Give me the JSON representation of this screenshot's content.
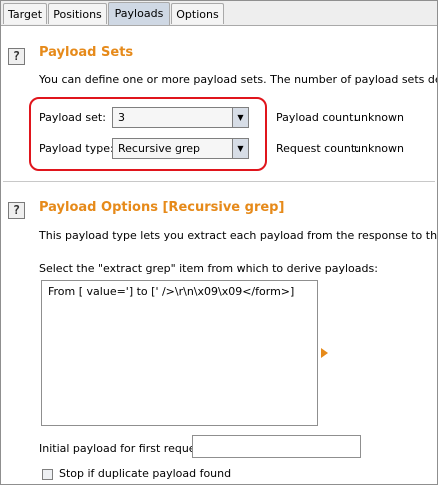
{
  "tabs": [
    {
      "label": "Target"
    },
    {
      "label": "Positions"
    },
    {
      "label": "Payloads"
    },
    {
      "label": "Options"
    }
  ],
  "active_tab": "Payloads",
  "payload_sets": {
    "help_icon": "?",
    "title": "Payload Sets",
    "description": "You can define one or more payload sets. The number of payload sets depends on",
    "payload_set_label": "Payload set:",
    "payload_set_value": "3",
    "payload_type_label": "Payload type:",
    "payload_type_value": "Recursive grep",
    "payload_count_label": "Payload count:",
    "payload_count_value": "unknown",
    "request_count_label": "Request count:",
    "request_count_value": "unknown"
  },
  "payload_options": {
    "help_icon": "?",
    "title": "Payload Options [Recursive grep]",
    "description": "This payload type lets you extract each payload from the response to the previous",
    "select_prompt": "Select the \"extract grep\" item from which to derive payloads:",
    "grep_items": [
      "From [ value='] to [' />\\r\\n\\x09\\x09</form>]"
    ],
    "initial_payload_label": "Initial payload for first request:",
    "initial_payload_value": "",
    "stop_duplicate_label": "Stop if duplicate payload found",
    "stop_duplicate_checked": false
  },
  "colors": {
    "accent": "#e68a1a",
    "highlight": "#e0151c",
    "active_tab": "#cfd8e4"
  }
}
